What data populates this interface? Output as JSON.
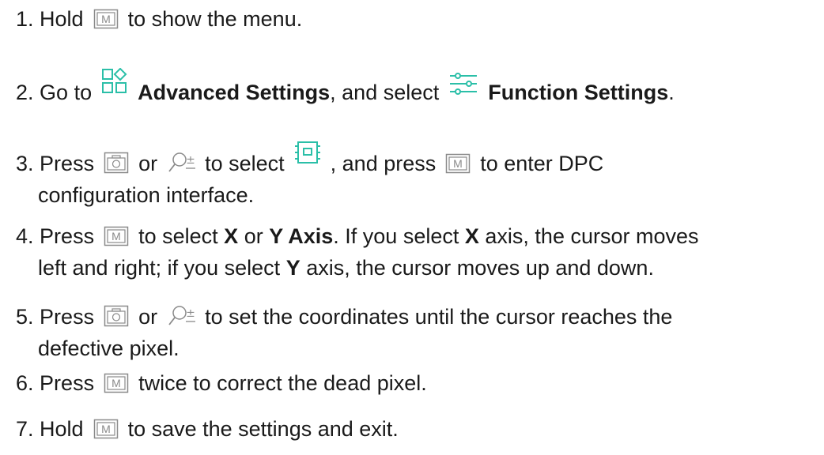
{
  "steps": [
    {
      "number": "1.",
      "parts": [
        "Hold",
        "to show the menu."
      ],
      "icons": [
        "m-button-icon"
      ]
    },
    {
      "number": "2.",
      "parts": [
        "Go to",
        "Advanced Settings",
        ", and select",
        "Function Settings",
        "."
      ],
      "icons": [
        "advanced-settings-icon",
        "function-settings-icon"
      ]
    },
    {
      "number": "3.",
      "parts": [
        "Press",
        "or",
        "to select",
        ", and press",
        "to enter DPC",
        "configuration interface."
      ],
      "icons": [
        "camera-button-icon",
        "zoom-button-icon",
        "dpc-icon",
        "m-button-icon"
      ]
    },
    {
      "number": "4.",
      "parts": [
        "Press",
        "to select",
        "X",
        "or",
        "Y Axis",
        ". If you select",
        "X",
        "axis, the cursor moves",
        "left and right; if you select",
        "Y",
        "axis, the cursor moves up and down."
      ],
      "icons": [
        "m-button-icon"
      ]
    },
    {
      "number": "5.",
      "parts": [
        "Press",
        "or",
        "to set the coordinates until the cursor reaches the",
        "defective pixel."
      ],
      "icons": [
        "camera-button-icon",
        "zoom-button-icon"
      ]
    },
    {
      "number": "6.",
      "parts": [
        "Press",
        "twice to correct the dead pixel."
      ],
      "icons": [
        "m-button-icon"
      ]
    },
    {
      "number": "7.",
      "parts": [
        "Hold",
        "to save the settings and exit."
      ],
      "icons": [
        "m-button-icon"
      ]
    }
  ],
  "colors": {
    "text": "#1a1a1a",
    "icon_gray": "#8a8a8a",
    "accent_teal": "#2bbfa8"
  }
}
